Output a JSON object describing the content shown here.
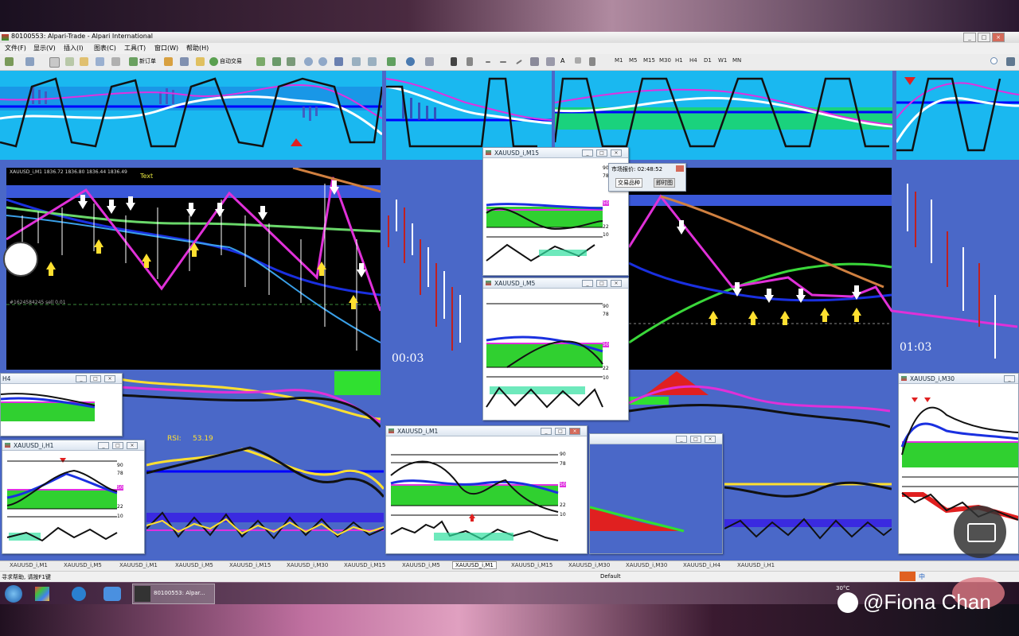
{
  "window": {
    "title": "80100553: Alpari-Trade - Alpari International",
    "controls": [
      "_",
      "□",
      "×"
    ]
  },
  "menu": {
    "items": [
      "文件(F)",
      "显示(V)",
      "插入(I)",
      "图表(C)",
      "工具(T)",
      "窗口(W)",
      "帮助(H)"
    ]
  },
  "toolbar": {
    "new_order": "新订单",
    "auto_trading": "自动交易",
    "timeframes": [
      "M1",
      "M5",
      "M15",
      "M30",
      "H1",
      "H4",
      "D1",
      "W1",
      "MN"
    ]
  },
  "charts": {
    "main_left": {
      "header": "XAUUSD_i,M1  1836.72 1836.80 1836.44 1836.49",
      "text_label": "Text",
      "timer": "00:03",
      "order_line": "#1624584245 sell 0.01"
    },
    "main_right": {
      "timer": "01:03"
    },
    "rsi_panel": {
      "label": "RSI:",
      "value": "53.19"
    },
    "h4_panel": {
      "title": "H4"
    }
  },
  "subwindows": [
    {
      "title": "XAUUSD_i,M15",
      "levels": [
        "90",
        "78",
        "50",
        "22",
        "10"
      ]
    },
    {
      "title": "XAUUSD_i,M5",
      "levels": [
        "90",
        "78",
        "50",
        "22",
        "10"
      ]
    },
    {
      "title": "XAUUSD_i,M1",
      "levels": [
        "90",
        "78",
        "50",
        "22",
        "10"
      ]
    },
    {
      "title": "XAUUSD_i,H1",
      "levels": [
        "90",
        "78",
        "50",
        "22",
        "10"
      ]
    },
    {
      "title": "XAUUSD_i,M30"
    }
  ],
  "market_watch": {
    "title": "市场报价: 02:48:52",
    "tab_symbols": "交易品种",
    "tab_tick": "即时图"
  },
  "tabs": [
    "XAUUSD_i,M1",
    "XAUUSD_i,M5",
    "XAUUSD_i,M1",
    "XAUUSD_i,M5",
    "XAUUSD_i,M15",
    "XAUUSD_i,M30",
    "XAUUSD_i,M15",
    "XAUUSD_i,M5",
    "XAUUSD_i,M1",
    "XAUUSD_i,M15",
    "XAUUSD_i,M30",
    "XAUUSD_i,M30",
    "XAUUSD_i,H4",
    "XAUUSD_i,H1"
  ],
  "active_tab_index": 8,
  "status": {
    "help": "寻求帮助, 请按F1键",
    "profile": "Default"
  },
  "taskbar": {
    "task": "80100553: Alpar...",
    "temperature": "30°C"
  },
  "watermark": "@Fiona Chan"
}
